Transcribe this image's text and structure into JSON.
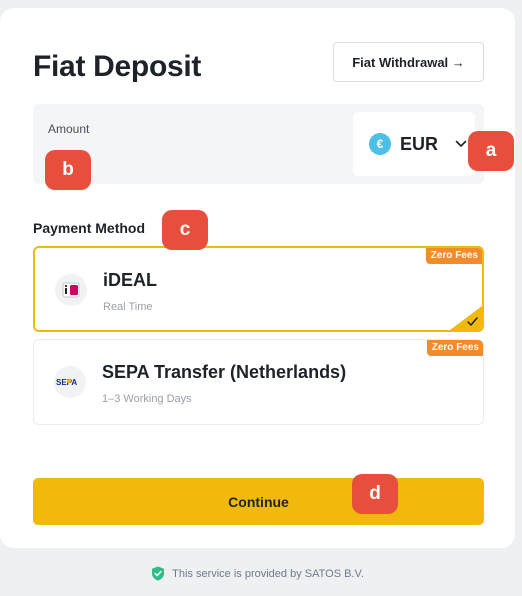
{
  "page": {
    "title": "Fiat Deposit",
    "withdraw_button": "Fiat Withdrawal →"
  },
  "amount": {
    "label": "Amount",
    "value": "",
    "placeholder": ""
  },
  "currency": {
    "icon_glyph": "€",
    "code": "EUR"
  },
  "payment": {
    "label": "Payment Method",
    "methods": [
      {
        "name": "iDEAL",
        "subtitle": "Real Time",
        "badge": "Zero Fees",
        "selected": true,
        "logo_text": "iD"
      },
      {
        "name": "SEPA Transfer (Netherlands)",
        "subtitle": "1–3 Working Days",
        "badge": "Zero Fees",
        "selected": false,
        "logo_text": "SEPA"
      }
    ]
  },
  "actions": {
    "continue_label": "Continue"
  },
  "markers": {
    "a": "a",
    "b": "b",
    "c": "c",
    "d": "d"
  },
  "footer": {
    "text": "This service is provided by SATOS B.V."
  },
  "colors": {
    "accent": "#f0b90b",
    "badge": "#f38a2c",
    "marker": "#e84e3c",
    "currency_icon": "#4cc0e6",
    "secure_check": "#2ebd85"
  }
}
